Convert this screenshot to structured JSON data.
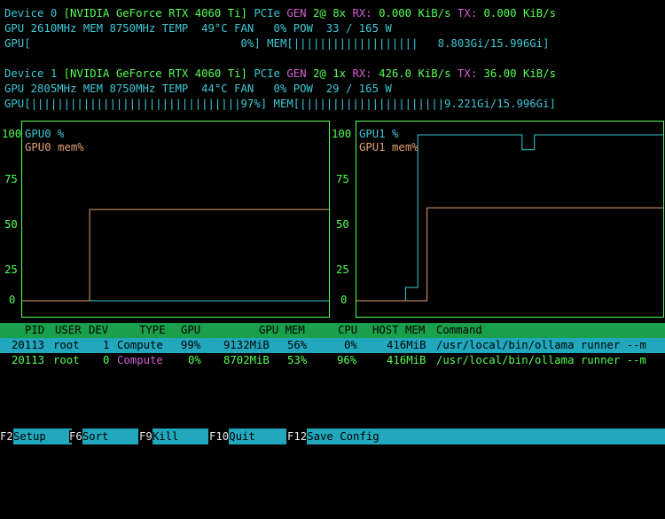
{
  "devices": [
    {
      "line1": {
        "device": "Device 0",
        "name": "[NVIDIA GeForce RTX 4060 Ti]",
        "pcie_label": "PCIe",
        "gen_label": "GEN",
        "gen_value": "2@ 8x",
        "rx_label": "RX:",
        "rx_value": "0.000 KiB/s",
        "tx_label": "TX:",
        "tx_value": "0.000 KiB/s"
      },
      "line2": "GPU 2610MHz MEM 8750MHz TEMP  49°C FAN   0% POW  33 / 165 W",
      "gpu_bar": "GPU[                                0%]",
      "mem_bar": "MEM[|||||||||||||||||||   8.803Gi/15.996Gi]"
    },
    {
      "line1": {
        "device": "Device 1",
        "name": "[NVIDIA GeForce RTX 4060 Ti]",
        "pcie_label": "PCIe",
        "gen_label": "GEN",
        "gen_value": "2@ 1x",
        "rx_label": "RX:",
        "rx_value": "426.0 KiB/s",
        "tx_label": "TX:",
        "tx_value": "36.00 KiB/s"
      },
      "line2": "GPU 2805MHz MEM 8750MHz TEMP  44°C FAN   0% POW  29 / 165 W",
      "gpu_bar": "GPU[||||||||||||||||||||||||||||||||97%]",
      "mem_bar": "MEM[||||||||||||||||||||||9.221Gi/15.996Gi]"
    }
  ],
  "chart_data": [
    {
      "type": "line",
      "ylim": [
        0,
        100
      ],
      "yticks": [
        "100",
        "75",
        "50",
        "25",
        "0"
      ],
      "series": [
        {
          "name": "GPU0 %",
          "color": "#3cc7d6",
          "x": [
            0,
            100
          ],
          "y": [
            0,
            0
          ]
        },
        {
          "name": "GPU0 mem%",
          "color": "#e0a070",
          "x": [
            0,
            22,
            22,
            100
          ],
          "y": [
            0,
            0,
            55,
            55
          ]
        }
      ]
    },
    {
      "type": "line",
      "ylim": [
        0,
        100
      ],
      "yticks": [
        "100",
        "75",
        "50",
        "25",
        "0"
      ],
      "series": [
        {
          "name": "GPU1 %",
          "color": "#3cc7d6",
          "x": [
            0,
            16,
            16,
            20,
            20,
            21,
            21,
            54,
            54,
            58,
            58,
            100
          ],
          "y": [
            0,
            0,
            8,
            8,
            100,
            100,
            100,
            100,
            91,
            91,
            100,
            100
          ]
        },
        {
          "name": "GPU1 mem%",
          "color": "#e0a070",
          "x": [
            0,
            23,
            23,
            100
          ],
          "y": [
            0,
            0,
            56,
            56
          ]
        }
      ]
    }
  ],
  "process_table": {
    "headers": {
      "pid": "PID",
      "user": "USER",
      "dev": "DEV",
      "type": "TYPE",
      "gpu": "GPU",
      "gpu_mem": "GPU MEM",
      "cpu": "CPU",
      "host_mem": "HOST MEM",
      "command": "Command"
    },
    "rows": [
      {
        "pid": "20113",
        "user": "root",
        "dev": "1",
        "type": "Compute",
        "gpu": "99%",
        "gpu_mem": "9132MiB",
        "gpu_mem_pct": "56%",
        "cpu": "0%",
        "host_mem": "416MiB",
        "command": "/usr/local/bin/ollama runner --m"
      },
      {
        "pid": "20113",
        "user": "root",
        "dev": "0",
        "type": "Compute",
        "gpu": "0%",
        "gpu_mem": "8702MiB",
        "gpu_mem_pct": "53%",
        "cpu": "96%",
        "host_mem": "416MiB",
        "command": "/usr/local/bin/ollama runner --m"
      }
    ]
  },
  "function_keys": [
    {
      "key": "F2",
      "label": "Setup"
    },
    {
      "key": "F6",
      "label": "Sort"
    },
    {
      "key": "F9",
      "label": "Kill"
    },
    {
      "key": "F10",
      "label": "Quit"
    },
    {
      "key": "F12",
      "label": "Save Config"
    }
  ]
}
